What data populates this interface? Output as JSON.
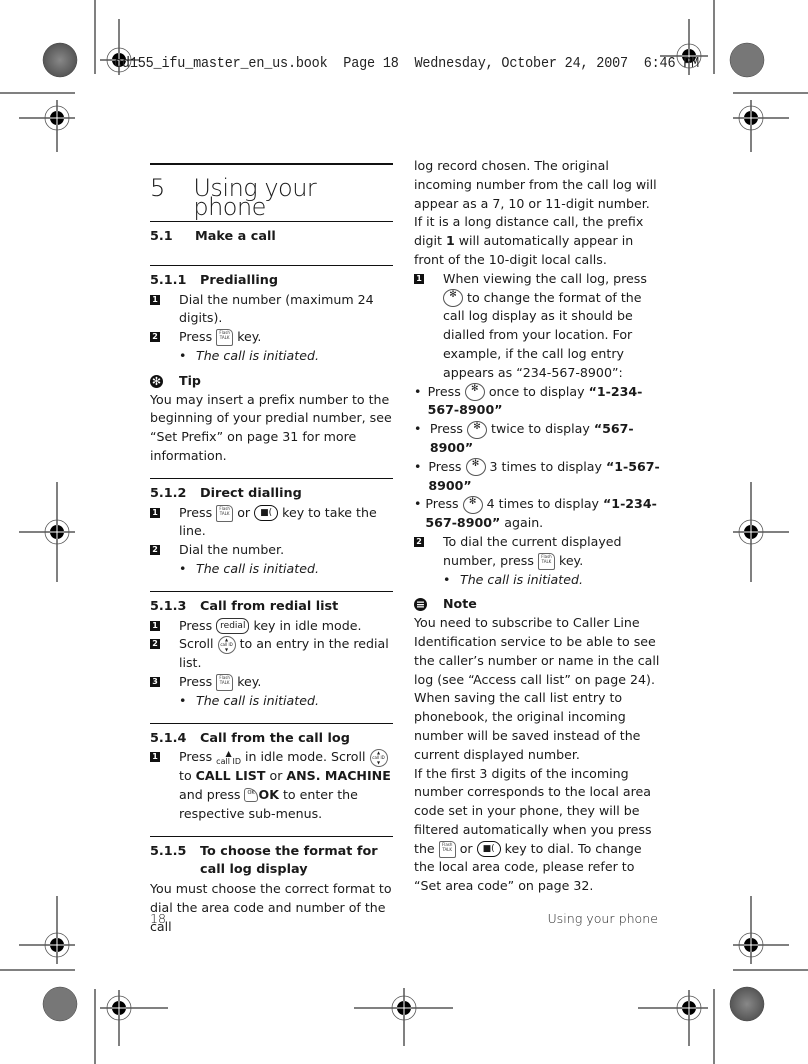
{
  "print_banner": "cd155_ifu_master_en_us.book  Page 18  Wednesday, October 24, 2007  6:46 PM",
  "chapter": {
    "number": "5",
    "title": "Using your phone"
  },
  "section": {
    "number": "5.1",
    "title": "Make a call"
  },
  "predialling": {
    "number": "5.1.1",
    "title": "Predialling",
    "steps": [
      {
        "badge": "1",
        "text": "Dial the number (maximum 24 digits)."
      },
      {
        "badge": "2",
        "before": "Press",
        "key": "talk-key",
        "after": "key."
      }
    ],
    "result": "The call is initiated."
  },
  "tip": {
    "label": "Tip",
    "text": "You may insert a prefix number to the beginning of your predial number, see “Set Prefix” on page 31 for more information."
  },
  "direct_dialling": {
    "number": "5.1.2",
    "title": "Direct dialling",
    "steps": [
      {
        "badge": "1",
        "before": "Press",
        "middle": "or",
        "after": "key to take the line."
      },
      {
        "badge": "2",
        "text": "Dial the number."
      }
    ],
    "result": "The call is initiated."
  },
  "redial_list": {
    "number": "5.1.3",
    "title": "Call from redial list",
    "steps": [
      {
        "badge": "1",
        "before": "Press",
        "key_label": "redial",
        "after": "key in idle mode."
      },
      {
        "badge": "2",
        "before": "Scroll",
        "after": "to an entry in the redial list."
      },
      {
        "badge": "3",
        "before": "Press",
        "after": "key."
      }
    ],
    "result": "The call is initiated."
  },
  "call_log": {
    "number": "5.1.4",
    "title": "Call from the call log",
    "step": {
      "badge": "1",
      "before": "Press",
      "callid_label": "call ID",
      "mid1": "in idle mode. Scroll",
      "mid2": "to",
      "bold1": "CALL LIST",
      "or": "or",
      "bold2": "ANS. MACHINE",
      "and_press": "and press",
      "ok": "OK",
      "after": "to enter the respective sub-menus."
    }
  },
  "format": {
    "number": "5.1.5",
    "title": "To choose the format for call log display",
    "intro_left": "You must choose the correct format to dial the area code and number of the call",
    "intro_right_a": "log record chosen. The original incoming number from the call log will appear as a 7, 10 or 11-digit number. If it is a long distance call, the prefix digit ",
    "intro_right_bold": "1",
    "intro_right_b": " will automatically appear in front of the 10-digit local calls.",
    "step1": {
      "badge": "1",
      "before": "When viewing the call log, press",
      "after": "to change the format of the call log display as it should be dialled from your location. For example, if the call log entry appears as",
      "example": "“234-567-8900”:"
    },
    "bullets": [
      {
        "before": "Press",
        "after": "once to display",
        "value": "“1-234-567-8900”"
      },
      {
        "before": "Press",
        "after": "twice to display",
        "value": "“567-8900”"
      },
      {
        "before": "Press",
        "after": "3 times to display",
        "value": "“1-567-8900”"
      },
      {
        "before": "Press",
        "after": "4 times to display",
        "value": "“1-234-567-8900”",
        "tail": " again."
      }
    ],
    "step2": {
      "badge": "2",
      "before": "To dial the current displayed number, press",
      "after": "key."
    },
    "result": "The call is initiated."
  },
  "note": {
    "label": "Note",
    "p1": "You need to subscribe to Caller Line Identification service to be able to see the caller’s number or name in the call log (see “Access call list” on page 24).",
    "p2": "When saving the call list entry to phonebook, the original incoming number will be saved instead of the current displayed number.",
    "p3_a": "If the first 3 digits of the incoming number corresponds to the local area code set in your phone, they will be filtered automatically when you press the",
    "p3_or": "or",
    "p3_b": "key to dial. To change the local area code, please refer to “Set area code” on page 32."
  },
  "keys": {
    "talk": "TALK",
    "talk_top": "Flash",
    "speaker": "■(",
    "nav_top": "call ID",
    "nav_bottom": "phbk",
    "fmt_top": "*⊶",
    "fmt_bottom": "format",
    "ok": "OK"
  },
  "footer": {
    "page_number": "18",
    "running_title": "Using your phone"
  }
}
